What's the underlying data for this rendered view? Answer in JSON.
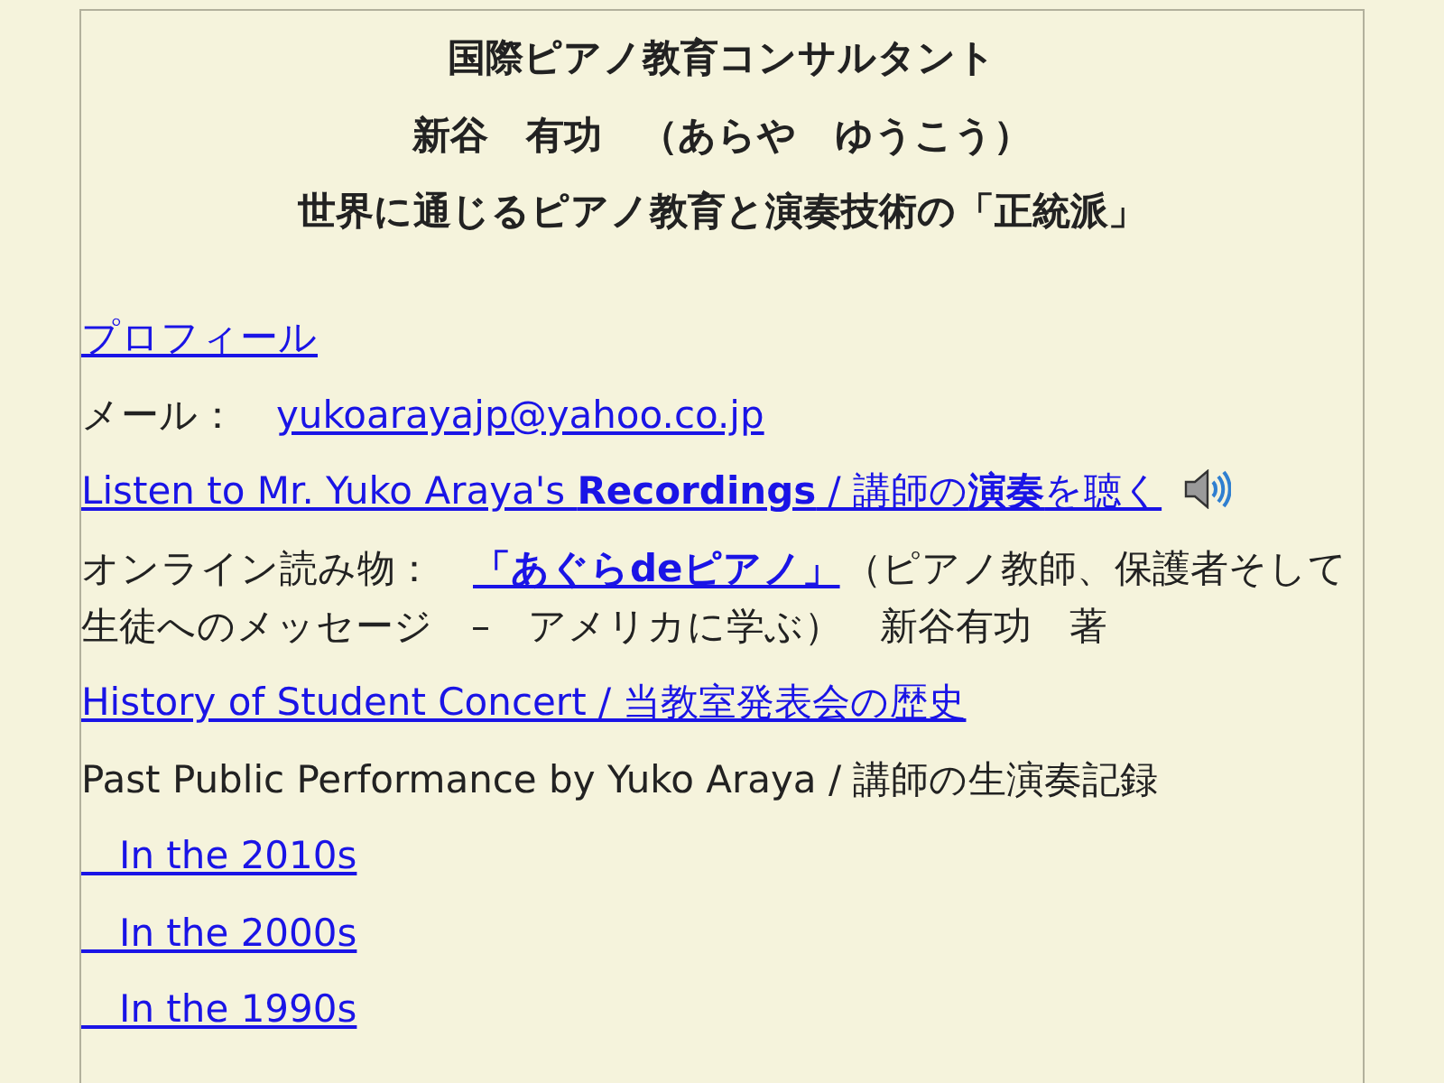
{
  "header": {
    "title": "国際ピアノ教育コンサルタント",
    "name": "新谷　有功　（あらや　ゆうこう）",
    "tagline": "世界に通じるピアノ教育と演奏技術の「正統派」"
  },
  "items": [
    {
      "kind": "link",
      "text": "プロフィール"
    },
    {
      "kind": "contact",
      "label": "メール：",
      "link": "yukoarayajp@yahoo.co.jp"
    },
    {
      "kind": "audio",
      "text": "Listen to Mr. Yuko Araya's **Recordings** / 講師の**演奏**を聴く"
    },
    {
      "kind": "reading",
      "label": "オンライン読み物：",
      "link": "「あぐらdeピアノ」",
      "note_lines": [
        "（ピアノ教師、保護者そして",
        "生徒へのメッセージ　–　アメリカに学ぶ）　新谷有功　著"
      ]
    },
    {
      "kind": "link",
      "text": "History of Student Concert / 当教室発表会の歴史"
    },
    {
      "kind": "text",
      "text": "Past Public Performance by Yuko Araya / 講師の生演奏記録"
    },
    {
      "kind": "sublink",
      "text": "　In the 2010s"
    },
    {
      "kind": "sublink",
      "text": "　In the 2000s"
    },
    {
      "kind": "sublink",
      "text": "　In the 1990s"
    }
  ]
}
